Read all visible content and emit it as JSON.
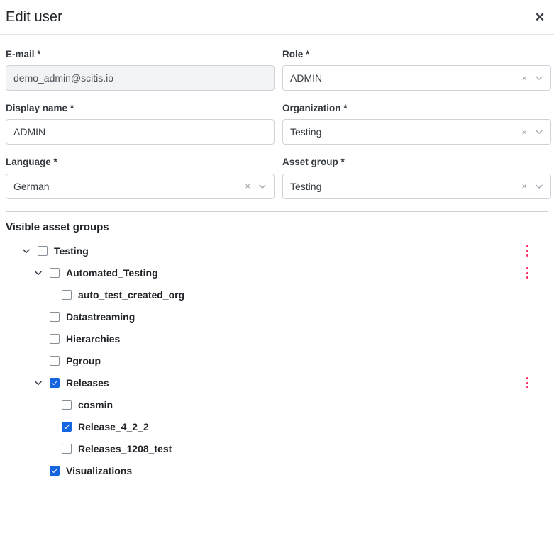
{
  "dialog": {
    "title": "Edit user",
    "close_label": "✕"
  },
  "form": {
    "rows": [
      {
        "left": {
          "label": "E-mail",
          "required": "*",
          "value": "demo_admin@scitis.io",
          "type": "readonly-text"
        },
        "right": {
          "label": "Role",
          "required": "*",
          "value": "ADMIN",
          "type": "select"
        }
      },
      {
        "left": {
          "label": "Display name",
          "required": "*",
          "value": "ADMIN",
          "type": "text"
        },
        "right": {
          "label": "Organization",
          "required": "*",
          "value": "Testing",
          "type": "select"
        }
      },
      {
        "left": {
          "label": "Language",
          "required": "*",
          "value": "German",
          "type": "select"
        },
        "right": {
          "label": "Asset group",
          "required": "*",
          "value": "Testing",
          "type": "select"
        }
      }
    ],
    "clear_glyph": "×"
  },
  "tree": {
    "title": "Visible asset groups",
    "nodes": [
      {
        "label": "Testing",
        "depth": 0,
        "checked": false,
        "expandable": true,
        "expanded": true,
        "kebab": true
      },
      {
        "label": "Automated_Testing",
        "depth": 1,
        "checked": false,
        "expandable": true,
        "expanded": true,
        "kebab": true
      },
      {
        "label": "auto_test_created_org",
        "depth": 2,
        "checked": false,
        "expandable": false,
        "expanded": false,
        "kebab": false
      },
      {
        "label": "Datastreaming",
        "depth": 1,
        "checked": false,
        "expandable": false,
        "expanded": false,
        "kebab": false
      },
      {
        "label": "Hierarchies",
        "depth": 1,
        "checked": false,
        "expandable": false,
        "expanded": false,
        "kebab": false
      },
      {
        "label": "Pgroup",
        "depth": 1,
        "checked": false,
        "expandable": false,
        "expanded": false,
        "kebab": false
      },
      {
        "label": "Releases",
        "depth": 1,
        "checked": true,
        "expandable": true,
        "expanded": true,
        "kebab": true
      },
      {
        "label": "cosmin",
        "depth": 2,
        "checked": false,
        "expandable": false,
        "expanded": false,
        "kebab": false
      },
      {
        "label": "Release_4_2_2",
        "depth": 2,
        "checked": true,
        "expandable": false,
        "expanded": false,
        "kebab": false
      },
      {
        "label": "Releases_1208_test",
        "depth": 2,
        "checked": false,
        "expandable": false,
        "expanded": false,
        "kebab": false
      },
      {
        "label": "Visualizations",
        "depth": 1,
        "checked": true,
        "expandable": false,
        "expanded": false,
        "kebab": false
      }
    ]
  },
  "colors": {
    "accent_checkbox": "#1565e0",
    "kebab_dots": "#f8265f",
    "border": "#ced4da",
    "divider": "#c9d0d6",
    "readonly_bg": "#f1f3f5"
  }
}
